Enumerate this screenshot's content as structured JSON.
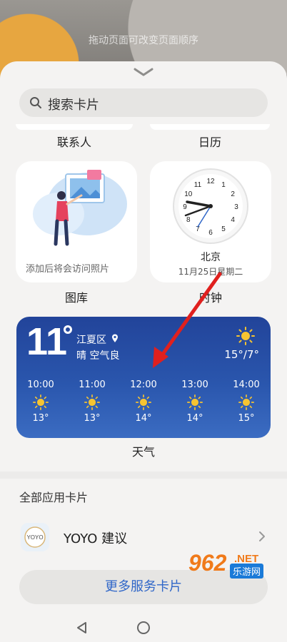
{
  "background": {
    "hint": "拖动页面可改变页面顺序"
  },
  "search": {
    "placeholder": "搜索卡片"
  },
  "top_cards": {
    "contacts_label": "联系人",
    "calendar_label": "日历"
  },
  "gallery": {
    "text": "添加后将会访问照片",
    "label": "图库"
  },
  "clock": {
    "city": "北京",
    "date": "11月25日星期二",
    "label": "时钟",
    "numbers": [
      "12",
      "1",
      "2",
      "3",
      "4",
      "5",
      "6",
      "7",
      "8",
      "9",
      "10",
      "11"
    ]
  },
  "weather": {
    "temp": "11",
    "location": "江夏区",
    "condition": "晴  空气良",
    "range": "15°/7°",
    "label": "天气",
    "hourly": [
      {
        "time": "10:00",
        "temp": "13°"
      },
      {
        "time": "11:00",
        "temp": "13°"
      },
      {
        "time": "12:00",
        "temp": "14°"
      },
      {
        "time": "13:00",
        "temp": "14°"
      },
      {
        "time": "14:00",
        "temp": "15°"
      }
    ]
  },
  "all_cards": {
    "title": "全部应用卡片",
    "yoyo_icon_text": "YOYO",
    "yoyo_label": "YOYO 建议"
  },
  "more_button": "更多服务卡片",
  "watermark": {
    "big": "962",
    "net": ".NET",
    "sub": "乐游网"
  },
  "colors": {
    "weather_bg": "#2a56ad",
    "accent_blue": "#2f66c8",
    "arrow_red": "#e0201e"
  }
}
